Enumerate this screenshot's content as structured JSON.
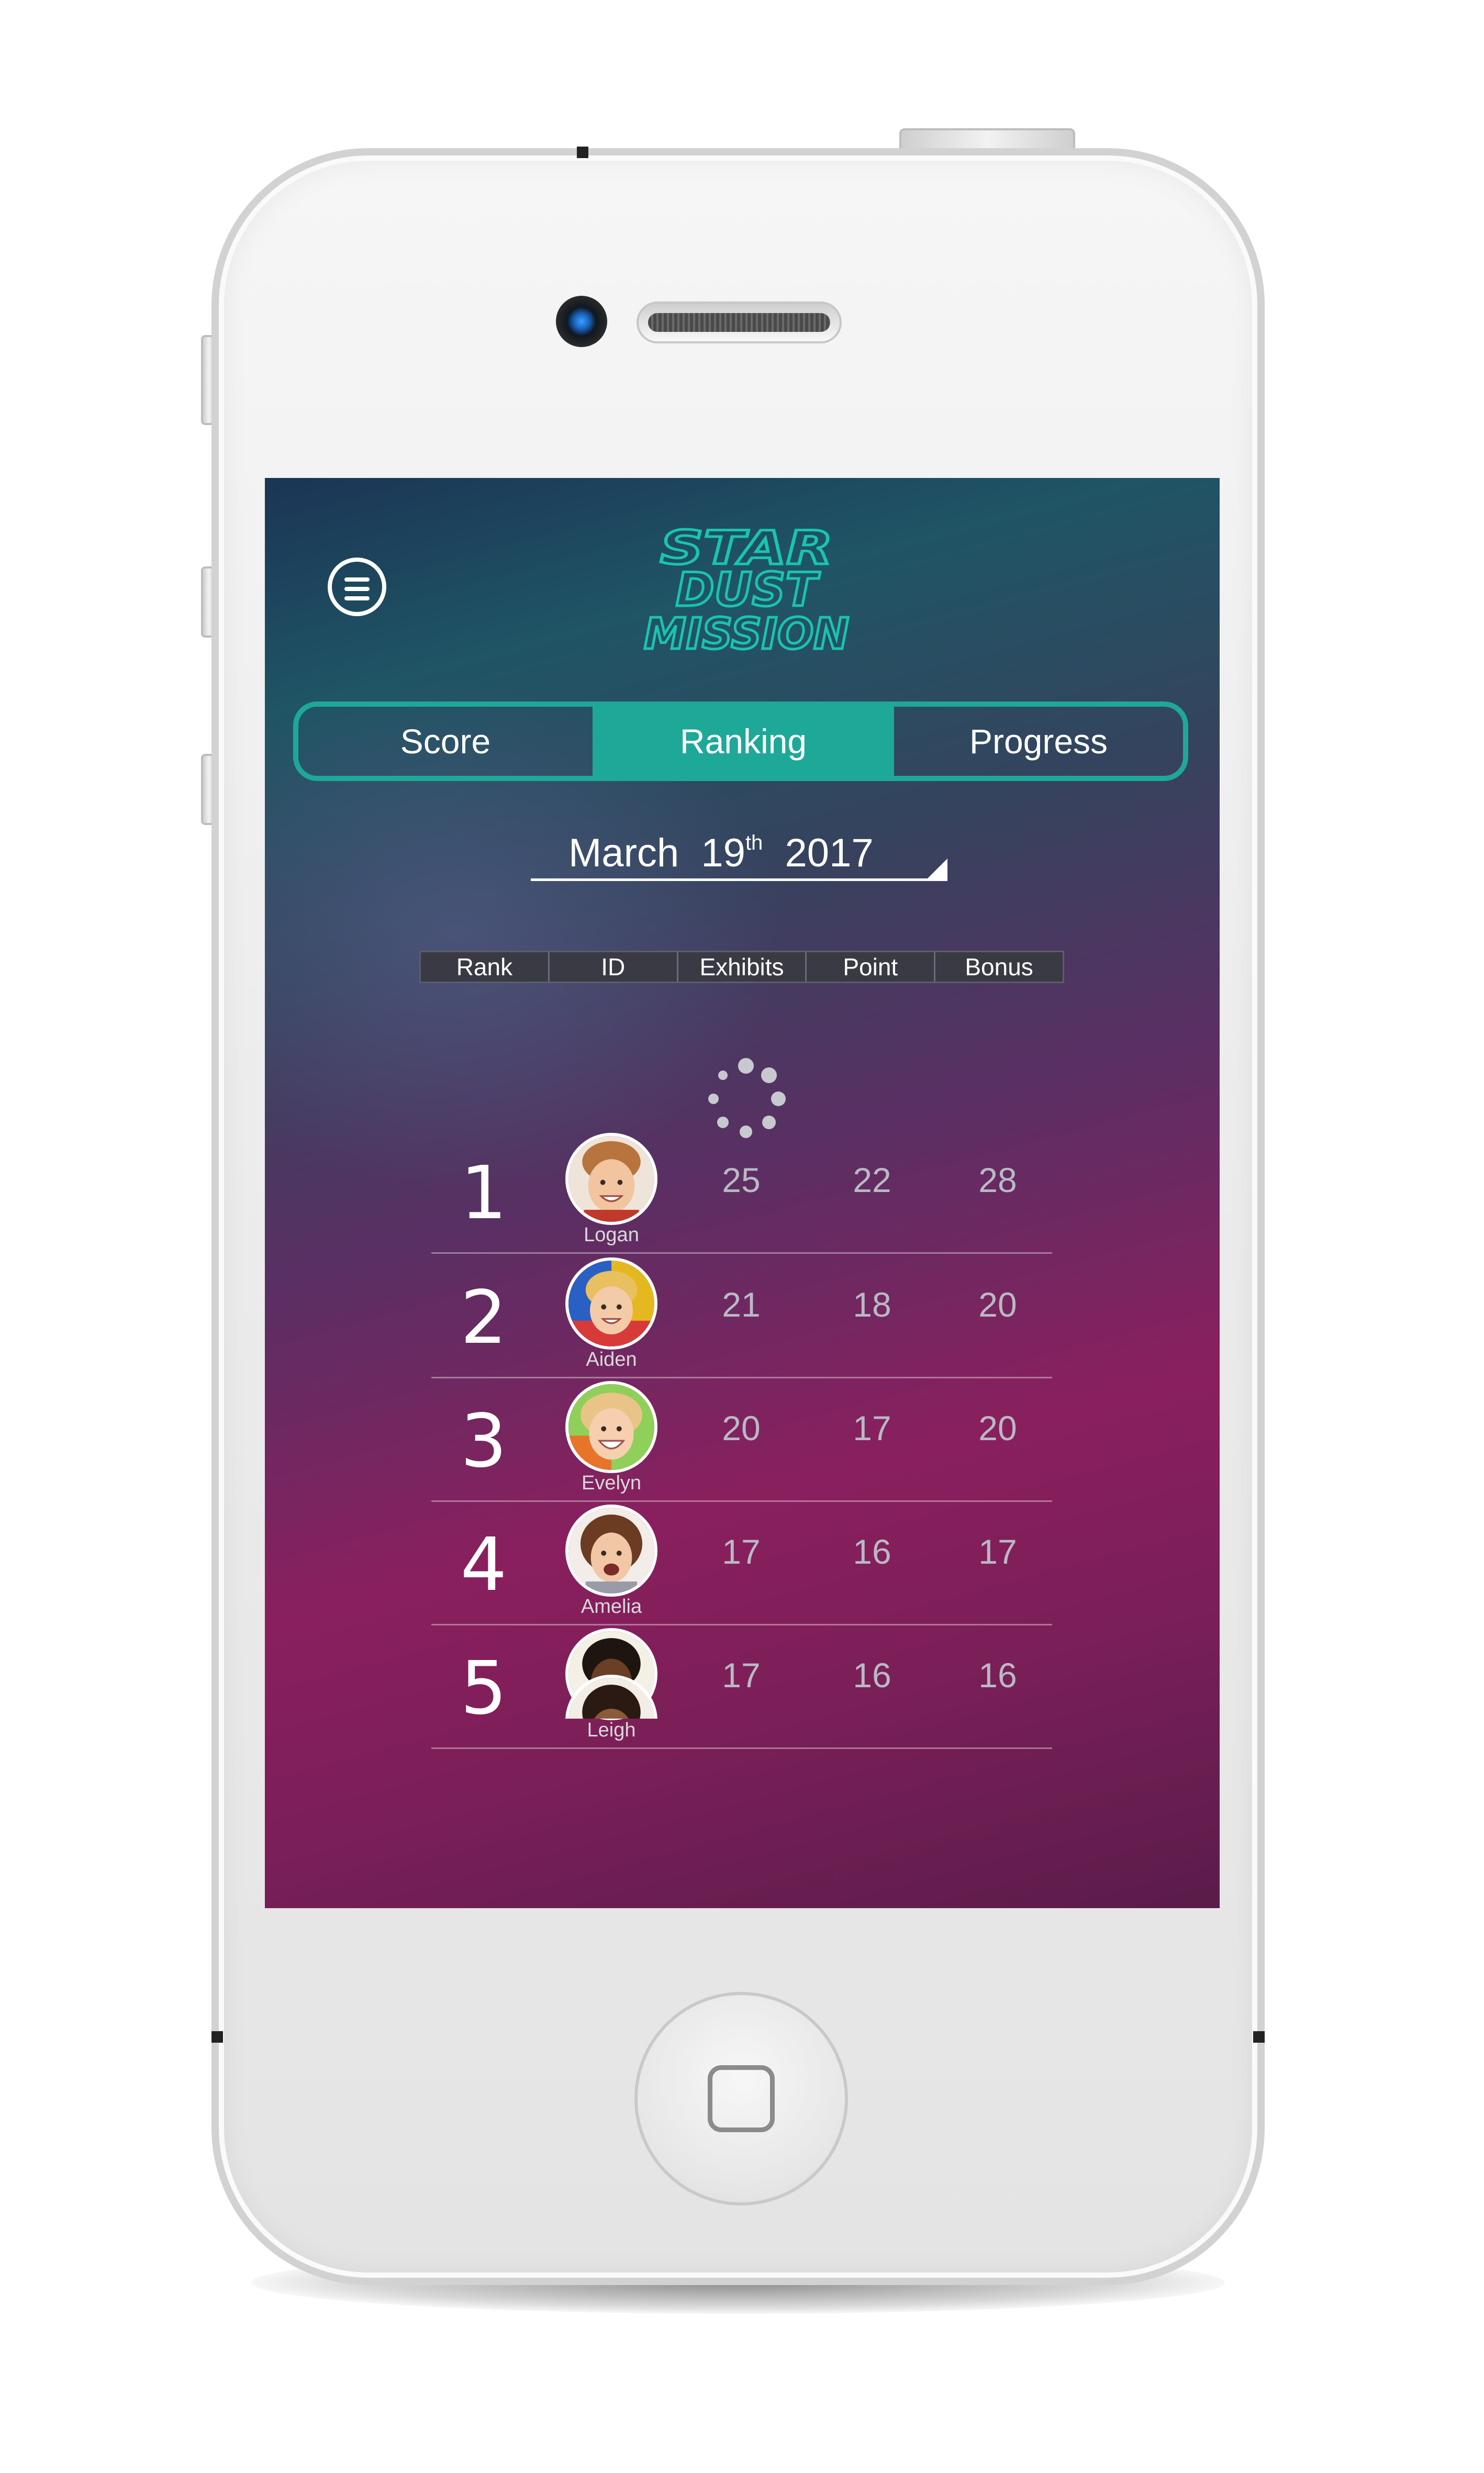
{
  "app": {
    "logo_lines": [
      "STAR",
      "DUST",
      "MISSION"
    ]
  },
  "tabs": [
    {
      "label": "Score",
      "active": false
    },
    {
      "label": "Ranking",
      "active": true
    },
    {
      "label": "Progress",
      "active": false
    }
  ],
  "date": {
    "month": "March",
    "day": "19",
    "suffix": "th",
    "year": "2017"
  },
  "table": {
    "headers": [
      "Rank",
      "ID",
      "Exhibits",
      "Point",
      "Bonus"
    ]
  },
  "rankings": [
    {
      "rank": "1",
      "name": "Logan",
      "exhibits": "25",
      "points": "22",
      "bonus": "28"
    },
    {
      "rank": "2",
      "name": "Aiden",
      "exhibits": "21",
      "points": "18",
      "bonus": "20"
    },
    {
      "rank": "3",
      "name": "Evelyn",
      "exhibits": "20",
      "points": "17",
      "bonus": "20"
    },
    {
      "rank": "4",
      "name": "Amelia",
      "exhibits": "17",
      "points": "16",
      "bonus": "17"
    },
    {
      "rank": "5",
      "name": "Leigh",
      "exhibits": "17",
      "points": "16",
      "bonus": "16"
    }
  ],
  "colors": {
    "accent": "#1ea898",
    "logo": "#19c4b0"
  },
  "icons": {
    "menu": "hamburger-menu-icon",
    "spinner": "loading-spinner-icon",
    "dropdown": "dropdown-arrow-icon"
  }
}
